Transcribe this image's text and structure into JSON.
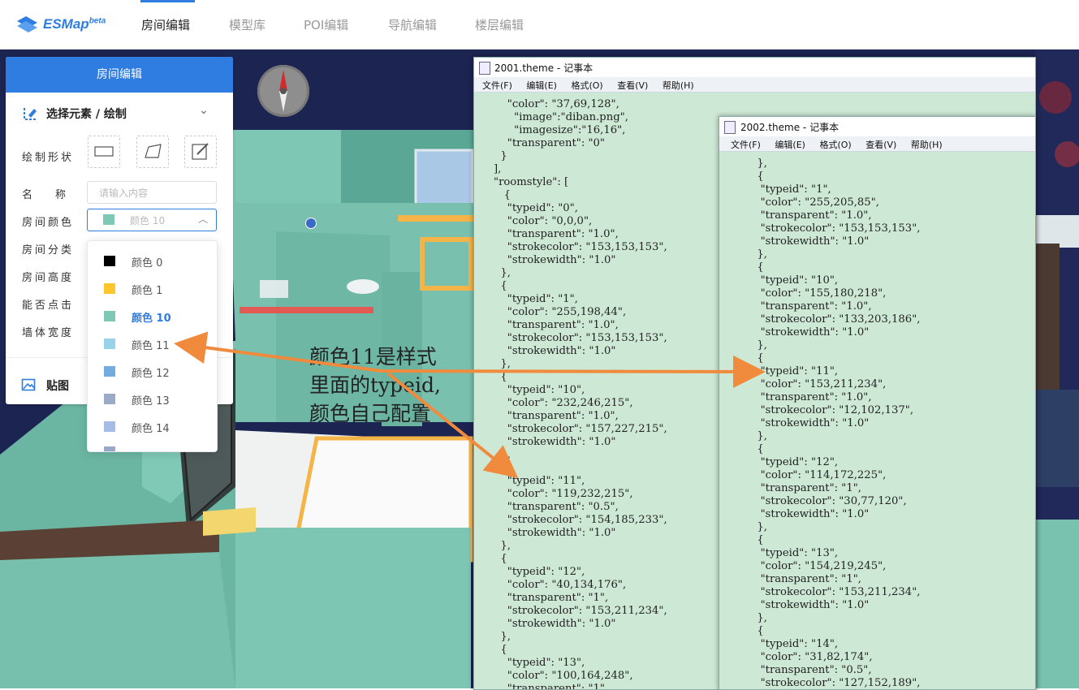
{
  "app": {
    "logo_name": "ESMap",
    "logo_sup": "beta"
  },
  "nav": [
    {
      "label": "房间编辑",
      "active": true
    },
    {
      "label": "模型库",
      "active": false
    },
    {
      "label": "POI编辑",
      "active": false
    },
    {
      "label": "导航编辑",
      "active": false
    },
    {
      "label": "楼层编辑",
      "active": false
    }
  ],
  "panel": {
    "title": "房间编辑",
    "section_title": "选择元素 / 绘制",
    "draw_shape_label": "绘制形状",
    "name_label": "名称",
    "name_placeholder": "请输入内容",
    "room_color_label": "房间颜色",
    "room_color_value": "颜色 10",
    "room_category_label": "房间分类",
    "room_height_label": "房间高度",
    "clickable_label": "能否点击",
    "wall_width_label": "墙体宽度",
    "texture_label": "贴图"
  },
  "color_options": [
    {
      "label": "颜色 0",
      "color": "#000000"
    },
    {
      "label": "颜色 1",
      "color": "#ffc62c"
    },
    {
      "label": "颜色 10",
      "color": "#7ec8b6",
      "selected": true
    },
    {
      "label": "颜色 11",
      "color": "#99d3ea"
    },
    {
      "label": "颜色 12",
      "color": "#72ace1"
    },
    {
      "label": "颜色 13",
      "color": "#9aabc7"
    },
    {
      "label": "颜色 14",
      "color": "#a5bde6"
    }
  ],
  "window1": {
    "title": "2001.theme - 记事本",
    "menu": [
      "文件(F)",
      "编辑(E)",
      "格式(O)",
      "查看(V)",
      "帮助(H)"
    ],
    "text": "    \"color\": \"37,69,128\",\n      \"image\":\"diban.png\",\n      \"imagesize\":\"16,16\",\n    \"transparent\": \"0\"\n  }\n],\n\"roomstyle\": [\n   {\n    \"typeid\": \"0\",\n    \"color\": \"0,0,0\",\n    \"transparent\": \"1.0\",\n    \"strokecolor\": \"153,153,153\",\n    \"strokewidth\": \"1.0\"\n  },\n  {\n    \"typeid\": \"1\",\n    \"color\": \"255,198,44\",\n    \"transparent\": \"1.0\",\n    \"strokecolor\": \"153,153,153\",\n    \"strokewidth\": \"1.0\"\n  },\n  {\n    \"typeid\": \"10\",\n    \"color\": \"232,246,215\",\n    \"transparent\": \"1.0\",\n    \"strokecolor\": \"157,227,215\",\n    \"strokewidth\": \"1.0\"\n  },\n  {\n    \"typeid\": \"11\",\n    \"color\": \"119,232,215\",\n    \"transparent\": \"0.5\",\n    \"strokecolor\": \"154,185,233\",\n    \"strokewidth\": \"1.0\"\n  },\n  {\n    \"typeid\": \"12\",\n    \"color\": \"40,134,176\",\n    \"transparent\": \"1\",\n    \"strokecolor\": \"153,211,234\",\n    \"strokewidth\": \"1.0\"\n  },\n  {\n    \"typeid\": \"13\",\n    \"color\": \"100,164,248\",\n    \"transparent\": \"1\","
  },
  "window2": {
    "title": "2002.theme - 记事本",
    "menu": [
      "文件(F)",
      "编辑(E)",
      "格式(O)",
      "查看(V)",
      "帮助(H)"
    ],
    "text": "  },\n  {\n   \"typeid\": \"1\",\n   \"color\": \"255,205,85\",\n   \"transparent\": \"1.0\",\n   \"strokecolor\": \"153,153,153\",\n   \"strokewidth\": \"1.0\"\n  },\n  {\n   \"typeid\": \"10\",\n   \"color\": \"155,180,218\",\n   \"transparent\": \"1.0\",\n   \"strokecolor\": \"133,203,186\",\n   \"strokewidth\": \"1.0\"\n  },\n  {\n   \"typeid\": \"11\",\n   \"color\": \"153,211,234\",\n   \"transparent\": \"1.0\",\n   \"strokecolor\": \"12,102,137\",\n   \"strokewidth\": \"1.0\"\n  },\n  {\n   \"typeid\": \"12\",\n   \"color\": \"114,172,225\",\n   \"transparent\": \"1\",\n   \"strokecolor\": \"30,77,120\",\n   \"strokewidth\": \"1.0\"\n  },\n  {\n   \"typeid\": \"13\",\n   \"color\": \"154,219,245\",\n   \"transparent\": \"1\",\n   \"strokecolor\": \"153,211,234\",\n   \"strokewidth\": \"1.0\"\n  },\n  {\n   \"typeid\": \"14\",\n   \"color\": \"31,82,174\",\n   \"transparent\": \"0.5\",\n   \"strokecolor\": \"127,152,189\","
  },
  "annotation": {
    "line1": "颜色11是样式",
    "line2": "里面的typeid,",
    "line3": "颜色自己配置"
  }
}
